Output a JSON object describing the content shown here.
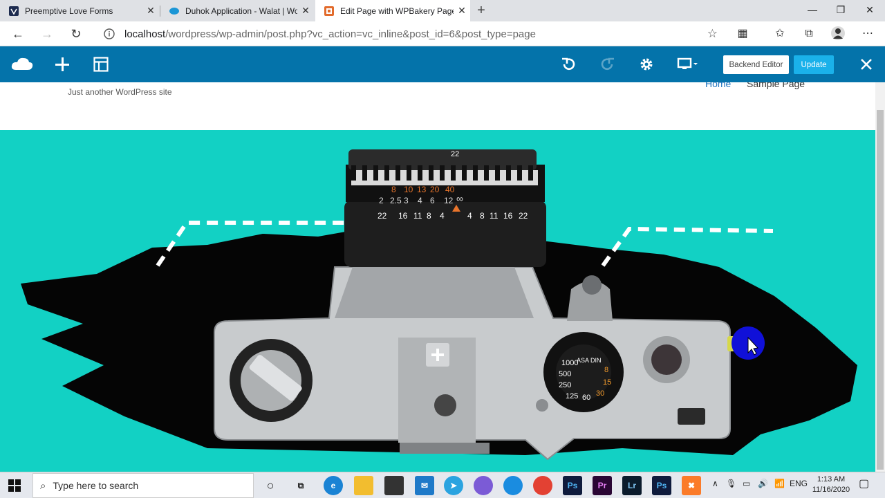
{
  "browser": {
    "tabs": [
      {
        "title": "Preemptive Love Forms",
        "active": false
      },
      {
        "title": "Duhok Application - Walat | Wor",
        "active": false
      },
      {
        "title": "Edit Page with WPBakery Page B",
        "active": true
      }
    ],
    "url_host": "localhost",
    "url_path": "/wordpress/wp-admin/post.php?vc_action=vc_inline&post_id=6&post_type=page"
  },
  "wpbakery": {
    "backend_editor_label": "Backend Editor",
    "update_label": "Update"
  },
  "site": {
    "tagline": "Just another WordPress site",
    "menu": [
      "Home",
      "Sample Page"
    ]
  },
  "hero": {
    "background": "#12d1c4",
    "lens_top_numbers": "22",
    "lens_orange_numbers": [
      "8",
      "10",
      "13",
      "20",
      "40"
    ],
    "lens_white_numbers": [
      "2",
      "2.5",
      "3",
      "4",
      "6",
      "12"
    ],
    "lens_bottom_numbers": [
      "22",
      "16",
      "11",
      "8",
      "4",
      "4",
      "8",
      "11",
      "16",
      "22"
    ],
    "dial_numbers": [
      "1000",
      "500",
      "250",
      "125",
      "60",
      "30",
      "15",
      "8"
    ],
    "dial_label": "ASA DIN"
  },
  "taskbar": {
    "search_placeholder": "Type here to search",
    "language": "ENG",
    "time": "1:13 AM",
    "date": "11/16/2020"
  },
  "colors": {
    "wp_bar": "#0473aa",
    "update_button": "#1ab1ea",
    "hero_bg": "#12d1c4"
  }
}
